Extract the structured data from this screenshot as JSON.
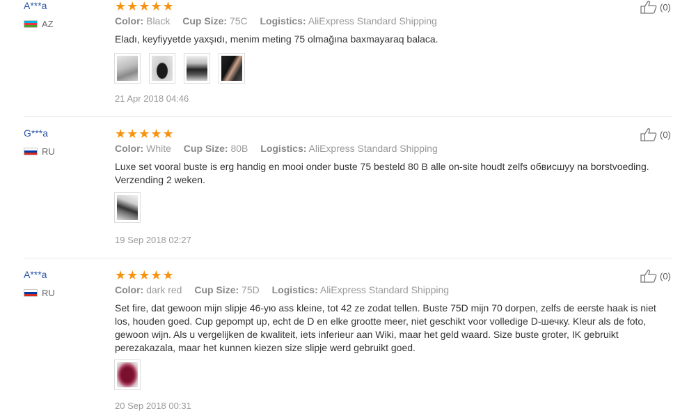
{
  "reviews": [
    {
      "buyer": "A***a",
      "country": "AZ",
      "color_label": "Color:",
      "color": "Black",
      "cup_label": "Cup Size:",
      "cup": "75C",
      "logistics_label": "Logistics:",
      "logistics": "AliExpress Standard Shipping",
      "text": "Eladı, keyfiyyetde yaxşıdı, menim meting 75 olmağına baxmayaraq balaca.",
      "photos": [
        "photo-1",
        "photo-2",
        "photo-3",
        "photo-4"
      ],
      "date": "21 Apr 2018 04:46",
      "helpful": "(0)"
    },
    {
      "buyer": "G***a",
      "country": "RU",
      "color_label": "Color:",
      "color": "White",
      "cup_label": "Cup Size:",
      "cup": "80B",
      "logistics_label": "Logistics:",
      "logistics": "AliExpress Standard Shipping",
      "text": "Luxe set vooral buste is erg handig en mooi onder buste 75 besteld 80 B alle on-site houdt zelfs обвисшуу na borstvoeding. Verzending 2 weken.",
      "photos": [
        "photo-1"
      ],
      "date": "19 Sep 2018 02:27",
      "helpful": "(0)"
    },
    {
      "buyer": "A***a",
      "country": "RU",
      "color_label": "Color:",
      "color": "dark red",
      "cup_label": "Cup Size:",
      "cup": "75D",
      "logistics_label": "Logistics:",
      "logistics": "AliExpress Standard Shipping",
      "text": "Set fire, dat gewoon mijn slipje 46-ую ass kleine, tot 42 ze zodat tellen. Buste 75D mijn 70 dorpen, zelfs de eerste haak is niet los, houden goed. Cup gepompt up, echt de D en elke grootte meer, niet geschikt voor volledige D-шечку. Kleur als de foto, gewoon wijn. Als u vergelijken de kwaliteit, iets inferieur aan Wiki, maar het geld waard. Size buste groter, IK gebruikt perezakazala, maar het kunnen kiezen size slipje werd gebruikt goed.",
      "photos": [
        "photo-1"
      ],
      "date": "20 Sep 2018 00:31",
      "helpful": "(0)"
    }
  ],
  "stars_glyph": "★★★★★",
  "rating": 5,
  "colors": {
    "star": "#f79311",
    "buyer_link": "#2a56a8"
  }
}
